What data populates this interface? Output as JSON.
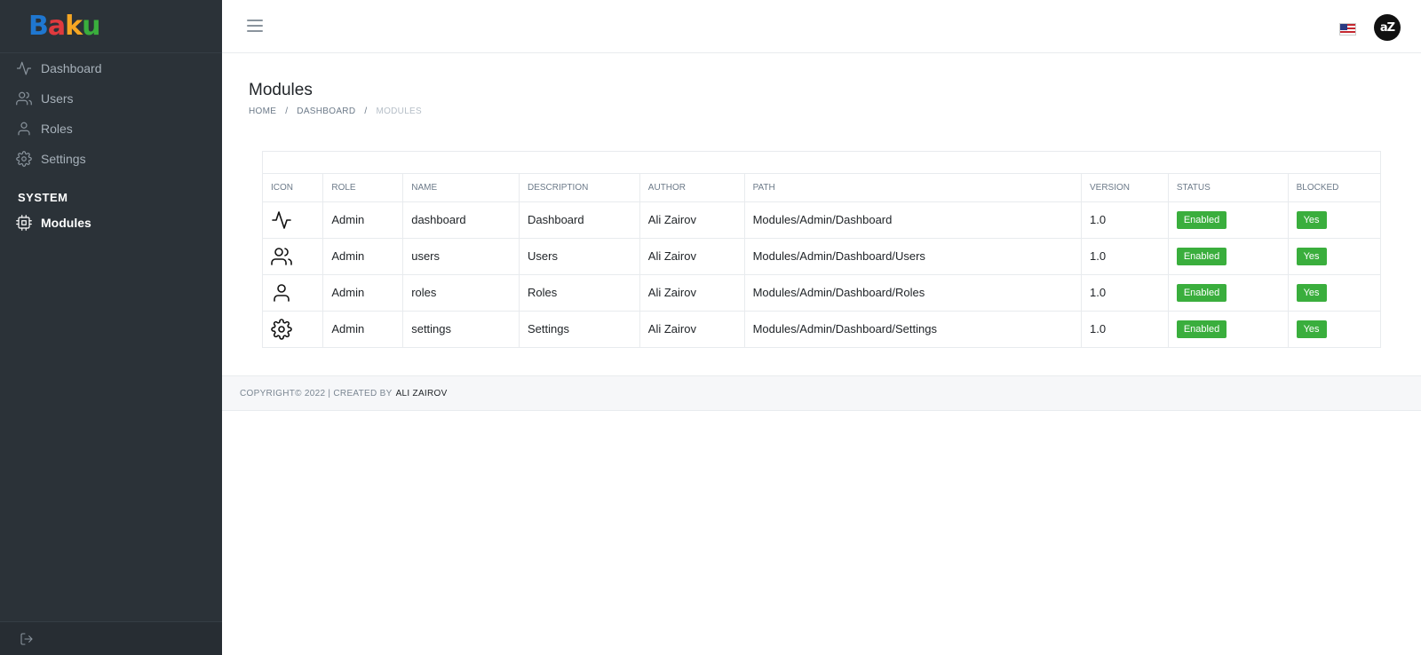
{
  "brand": {
    "letters": [
      {
        "char": "B",
        "color": "#1f77d0"
      },
      {
        "char": "a",
        "color": "#e03a3e"
      },
      {
        "char": "k",
        "color": "#f5a623"
      },
      {
        "char": "u",
        "color": "#3aae3d"
      }
    ]
  },
  "sidebar": {
    "items": [
      {
        "label": "Dashboard",
        "icon": "activity-icon"
      },
      {
        "label": "Users",
        "icon": "users-icon"
      },
      {
        "label": "Roles",
        "icon": "user-icon"
      },
      {
        "label": "Settings",
        "icon": "settings-icon"
      }
    ],
    "section_label": "SYSTEM",
    "section_items": [
      {
        "label": "Modules",
        "icon": "cpu-icon",
        "active": true
      }
    ],
    "footer_icon": "logout-icon"
  },
  "topbar": {
    "avatar_text": "aZ"
  },
  "page": {
    "title": "Modules",
    "breadcrumb": {
      "home": "HOME",
      "dashboard": "DASHBOARD",
      "current": "MODULES",
      "separator": "/"
    }
  },
  "table": {
    "columns": [
      "ICON",
      "ROLE",
      "NAME",
      "DESCRIPTION",
      "AUTHOR",
      "PATH",
      "VERSION",
      "STATUS",
      "BLOCKED"
    ],
    "rows": [
      {
        "icon": "activity-icon",
        "role": "Admin",
        "name": "dashboard",
        "description": "Dashboard",
        "author": "Ali Zairov",
        "path": "Modules/Admin/Dashboard",
        "version": "1.0",
        "status": "Enabled",
        "blocked": "Yes"
      },
      {
        "icon": "users-icon",
        "role": "Admin",
        "name": "users",
        "description": "Users",
        "author": "Ali Zairov",
        "path": "Modules/Admin/Dashboard/Users",
        "version": "1.0",
        "status": "Enabled",
        "blocked": "Yes"
      },
      {
        "icon": "user-icon",
        "role": "Admin",
        "name": "roles",
        "description": "Roles",
        "author": "Ali Zairov",
        "path": "Modules/Admin/Dashboard/Roles",
        "version": "1.0",
        "status": "Enabled",
        "blocked": "Yes"
      },
      {
        "icon": "settings-icon",
        "role": "Admin",
        "name": "settings",
        "description": "Settings",
        "author": "Ali Zairov",
        "path": "Modules/Admin/Dashboard/Settings",
        "version": "1.0",
        "status": "Enabled",
        "blocked": "Yes"
      }
    ]
  },
  "footer": {
    "copyright": "COPYRIGHT© 2022 | CREATED BY",
    "author": "ALI ZAIROV"
  },
  "colors": {
    "sidebar_bg": "#2b3238",
    "badge_green": "#3aae3d"
  }
}
